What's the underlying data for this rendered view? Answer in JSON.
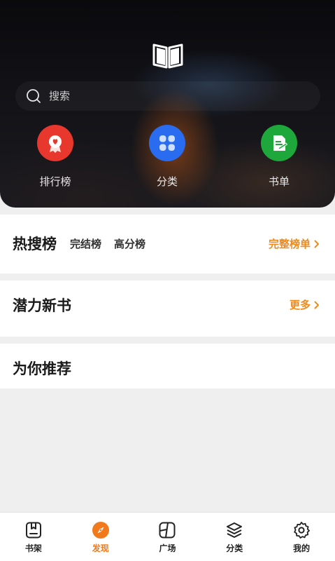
{
  "search": {
    "placeholder": "搜索"
  },
  "quick_links": [
    {
      "label": "排行榜",
      "icon": "ranking-badge-icon",
      "color": "#e8372c"
    },
    {
      "label": "分类",
      "icon": "category-grid-icon",
      "color": "#2a6cf0"
    },
    {
      "label": "书单",
      "icon": "booklist-icon",
      "color": "#1ea83c"
    }
  ],
  "hot_search": {
    "title": "热搜榜",
    "tabs": [
      "完结榜",
      "高分榜"
    ],
    "more_label": "完整榜单"
  },
  "new_books": {
    "title": "潜力新书",
    "more_label": "更多"
  },
  "recommend": {
    "title": "为你推荐"
  },
  "bottom_nav": {
    "active_index": 1,
    "accent": "#f07a1c",
    "items": [
      {
        "label": "书架",
        "icon": "bookshelf-icon"
      },
      {
        "label": "发现",
        "icon": "compass-icon"
      },
      {
        "label": "广场",
        "icon": "square-icon"
      },
      {
        "label": "分类",
        "icon": "layers-icon"
      },
      {
        "label": "我的",
        "icon": "settings-icon"
      }
    ]
  }
}
